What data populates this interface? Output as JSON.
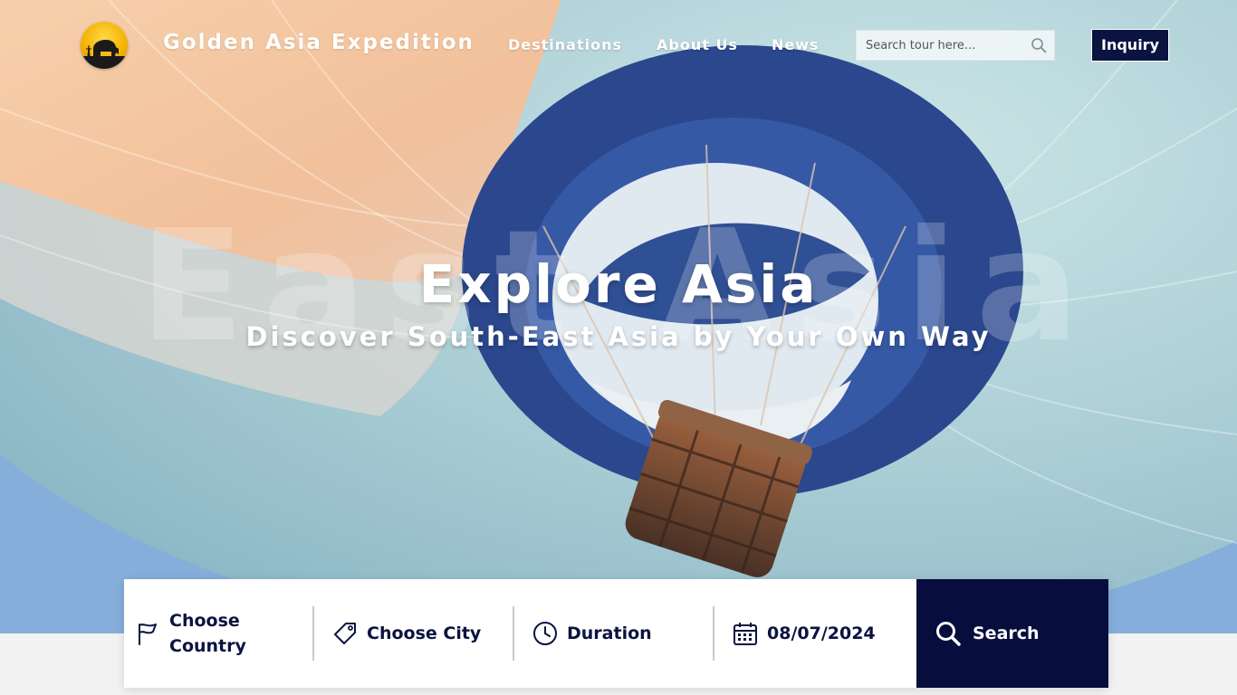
{
  "nav": {
    "brand": "Golden Asia Expedition",
    "links": [
      "Destinations",
      "About Us",
      "News"
    ],
    "search_placeholder": "Search tour here...",
    "inquiry_label": "Inquiry"
  },
  "hero": {
    "watermark": "East Asia",
    "title": "Explore Asia",
    "subtitle": "Discover South-East Asia by Your Own Way"
  },
  "search_bar": {
    "country_label": "Choose Country",
    "city_label": "Choose City",
    "duration_label": "Duration",
    "date_value": "08/07/2024",
    "search_label": "Search"
  },
  "colors": {
    "navy": "#0b1340",
    "search_button": "#070d3d",
    "balloon_light": "#a9cfd6",
    "balloon_peach": "#f0c19a",
    "balloon_navy": "#1e3c86",
    "sky": "#7ea9d9"
  },
  "icons": [
    "search-icon",
    "flag-icon",
    "tag-icon",
    "clock-icon",
    "calendar-icon",
    "elephant-logo"
  ]
}
